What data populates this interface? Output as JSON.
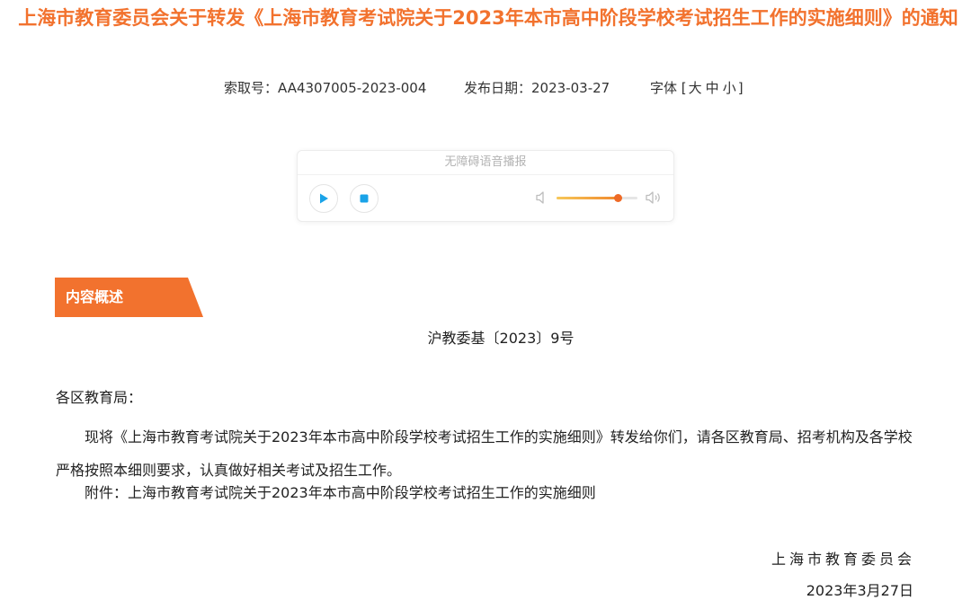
{
  "header": {
    "title": "上海市教育委员会关于转发《上海市教育考试院关于2023年本市高中阶段学校考试招生工作的实施细则》的通知"
  },
  "meta": {
    "index_label": "索取号：",
    "index_value": "AA4307005-2023-004",
    "date_label": "发布日期：",
    "date_value": "2023-03-27",
    "font_label": "字体",
    "font_open": "[",
    "font_large": "大",
    "font_medium": "中",
    "font_small": "小",
    "font_close": "]"
  },
  "player": {
    "label": "无障碍语音播报",
    "volume_fraction": 0.76,
    "colors": {
      "accent": "#f08a2e",
      "play": "#1aa3e8"
    }
  },
  "section": {
    "tab_label": "内容概述",
    "color": "#f2722e"
  },
  "document": {
    "number": "沪教委基〔2023〕9号",
    "salutation": "各区教育局：",
    "paragraph1": "现将《上海市教育考试院关于2023年本市高中阶段学校考试招生工作的实施细则》转发给你们，请各区教育局、招考机构及各学校严格按照本细则要求，认真做好相关考试及招生工作。",
    "attachment": "附件：上海市教育考试院关于2023年本市高中阶段学校考试招生工作的实施细则",
    "signature": "上海市教育委员会",
    "sign_date": "2023年3月27日"
  }
}
